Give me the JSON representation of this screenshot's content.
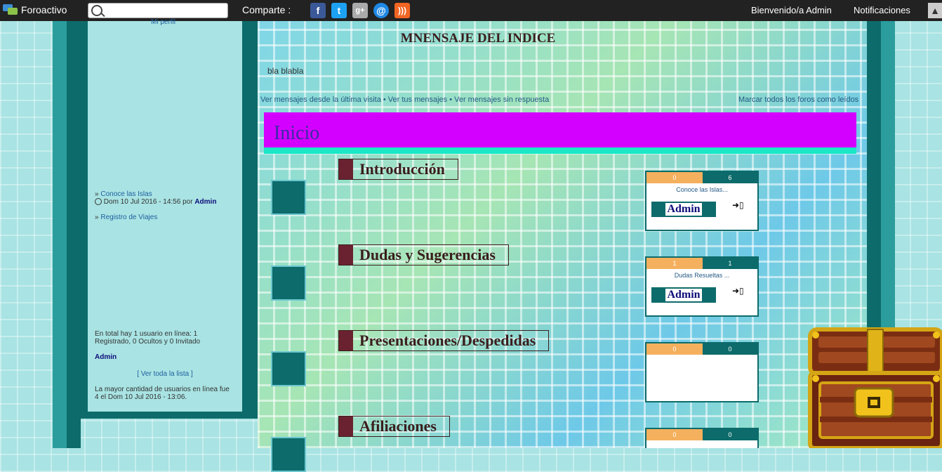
{
  "topbar": {
    "brand": "Foroactivo",
    "search_placeholder": "",
    "share_label": "Comparte :",
    "share_icons": [
      "facebook-icon",
      "twitter-icon",
      "google-plus-icon",
      "email-icon",
      "rss-icon"
    ],
    "welcome": "Bienvenido/a Admin",
    "notifications": "Notificaciones"
  },
  "sidebar": {
    "profile_link": "Mi perfil",
    "recent": [
      {
        "title": "Conoce las Islas",
        "date": "Dom 10 Jul 2016 - 14:56 por",
        "author": "Admin"
      },
      {
        "title": "Registro de Viajes"
      }
    ],
    "online_text": "En total hay 1 usuario en línea: 1 Registrado, 0 Ocultos y 0 Invitado",
    "online_admin": "Admin",
    "view_list": "[ Ver toda la lista ]",
    "record_text": "La mayor cantidad de usuarios en línea fue 4 el Dom 10 Jul 2016 - 13:06."
  },
  "main": {
    "index_title": "MNENSAJE DEL INDICE",
    "index_body": "bla blabla",
    "links_left": "Ver mensajes desde la última visita • Ver tus mensajes • Ver mensajes sin respuesta",
    "links_right": "Marcar todos los foros como leídos",
    "category": "Inicio",
    "forums": [
      {
        "name": "Introducción",
        "topics": "0",
        "posts": "6",
        "last": "Conoce las Islas...",
        "author": "Admin"
      },
      {
        "name": "Dudas y Sugerencias",
        "topics": "1",
        "posts": "1",
        "last": "Dudas Resueltas ...",
        "author": "Admin"
      },
      {
        "name": "Presentaciones/Despedidas",
        "topics": "0",
        "posts": "0",
        "last": "",
        "author": ""
      },
      {
        "name": "Afiliaciones",
        "topics": "0",
        "posts": "0",
        "last": "",
        "author": ""
      }
    ]
  },
  "colors": {
    "toolbar": "#222222",
    "frame": "#0d6b6b",
    "category_bar": "#d400ff",
    "category_border": "#1ae8c7",
    "topics_bg": "#f5b05e"
  }
}
